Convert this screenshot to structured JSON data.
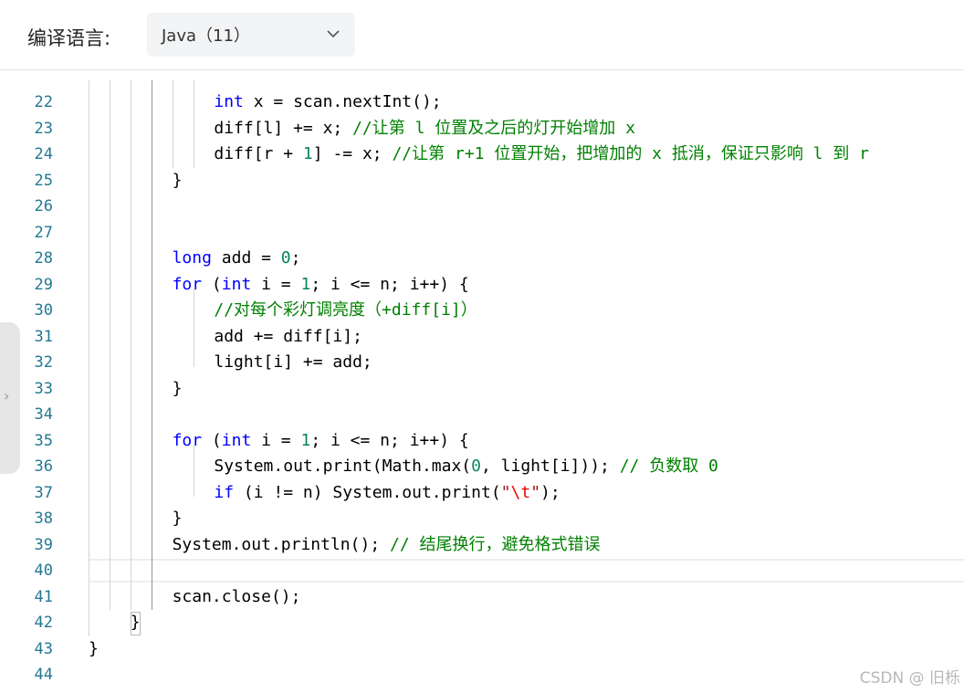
{
  "header": {
    "label": "编译语言:",
    "selected_language": "Java（11）"
  },
  "code_lines": [
    {
      "num": "22",
      "indent": 6,
      "tokens": [
        [
          "kw",
          "int"
        ],
        [
          "",
          "x = scan.nextInt();"
        ]
      ]
    },
    {
      "num": "23",
      "indent": 6,
      "tokens": [
        [
          "",
          "diff[l] += x; "
        ],
        [
          "cm",
          "//让第 l 位置及之后的灯开始增加 x"
        ]
      ]
    },
    {
      "num": "24",
      "indent": 6,
      "tokens": [
        [
          "",
          "diff[r + "
        ],
        [
          "num",
          "1"
        ],
        [
          "",
          "] -= x; "
        ],
        [
          "cm",
          "//让第 r+1 位置开始，把增加的 x 抵消，保证只影响 l 到 r"
        ]
      ]
    },
    {
      "num": "25",
      "indent": 4,
      "tokens": [
        [
          "",
          "}"
        ]
      ]
    },
    {
      "num": "26",
      "indent": 0,
      "tokens": []
    },
    {
      "num": "27",
      "indent": 0,
      "tokens": []
    },
    {
      "num": "28",
      "indent": 4,
      "tokens": [
        [
          "kw",
          "long"
        ],
        [
          "",
          " add = "
        ],
        [
          "num",
          "0"
        ],
        [
          "",
          ";"
        ]
      ]
    },
    {
      "num": "29",
      "indent": 4,
      "tokens": [
        [
          "kw",
          "for"
        ],
        [
          "",
          " ("
        ],
        [
          "kw",
          "int"
        ],
        [
          "",
          " i = "
        ],
        [
          "num",
          "1"
        ],
        [
          "",
          "; i <= n; i++) {"
        ]
      ]
    },
    {
      "num": "30",
      "indent": 6,
      "tokens": [
        [
          "cm",
          "//对每个彩灯调亮度（+diff[i]）"
        ]
      ]
    },
    {
      "num": "31",
      "indent": 6,
      "tokens": [
        [
          "",
          "add += diff[i];"
        ]
      ]
    },
    {
      "num": "32",
      "indent": 6,
      "tokens": [
        [
          "",
          "light[i] += add;"
        ]
      ]
    },
    {
      "num": "33",
      "indent": 4,
      "tokens": [
        [
          "",
          "}"
        ]
      ]
    },
    {
      "num": "34",
      "indent": 0,
      "tokens": []
    },
    {
      "num": "35",
      "indent": 4,
      "tokens": [
        [
          "kw",
          "for"
        ],
        [
          "",
          " ("
        ],
        [
          "kw",
          "int"
        ],
        [
          "",
          " i = "
        ],
        [
          "num",
          "1"
        ],
        [
          "",
          "; i <= n; i++) {"
        ]
      ]
    },
    {
      "num": "36",
      "indent": 6,
      "tokens": [
        [
          "",
          "System.out.print(Math.max("
        ],
        [
          "num",
          "0"
        ],
        [
          "",
          ", light[i])); "
        ],
        [
          "cm",
          "// 负数取 0"
        ]
      ]
    },
    {
      "num": "37",
      "indent": 6,
      "tokens": [
        [
          "kw",
          "if"
        ],
        [
          "",
          " (i != n) System.out.print("
        ],
        [
          "str",
          "\""
        ],
        [
          "esc",
          "\\t"
        ],
        [
          "str",
          "\""
        ],
        [
          "",
          ");"
        ]
      ]
    },
    {
      "num": "38",
      "indent": 4,
      "tokens": [
        [
          "",
          "}"
        ]
      ]
    },
    {
      "num": "39",
      "indent": 4,
      "tokens": [
        [
          "",
          "System.out.println(); "
        ],
        [
          "cm",
          "// 结尾换行，避免格式错误"
        ]
      ]
    },
    {
      "num": "40",
      "indent": 0,
      "tokens": []
    },
    {
      "num": "41",
      "indent": 4,
      "tokens": [
        [
          "",
          "scan.close();"
        ]
      ]
    },
    {
      "num": "42",
      "indent": 2,
      "tokens": [
        [
          "",
          "}"
        ]
      ]
    },
    {
      "num": "43",
      "indent": 0,
      "tokens": [
        [
          "",
          "}"
        ]
      ]
    },
    {
      "num": "44",
      "indent": 0,
      "tokens": []
    }
  ],
  "watermark": "CSDN @ 旧栎",
  "colors": {
    "keyword": "#0000ff",
    "number": "#098658",
    "comment": "#008000",
    "string": "#a31515",
    "line_number": "#237893"
  }
}
